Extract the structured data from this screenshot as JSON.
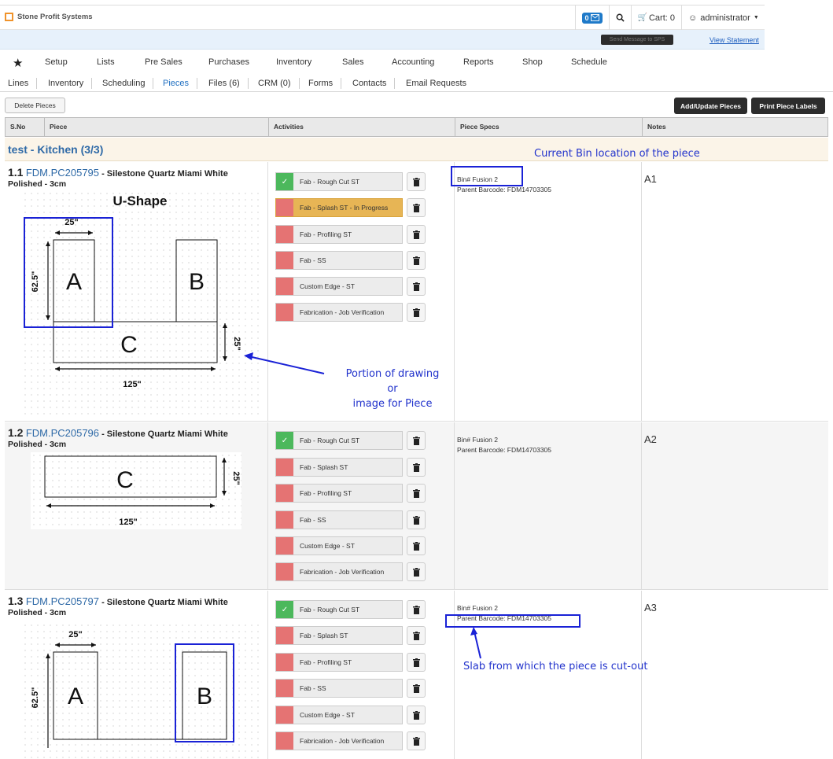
{
  "header": {
    "brand": "Stone Profit Systems",
    "message_count": "0",
    "cart_label": "Cart: 0",
    "user": "administrator"
  },
  "notice": {
    "send_message": "Send Message to SPS",
    "view_statement": "View Statement"
  },
  "nav": {
    "items": [
      "Setup",
      "Lists",
      "Pre Sales",
      "Purchases",
      "Inventory",
      "Sales",
      "Accounting",
      "Reports",
      "Shop",
      "Schedule"
    ]
  },
  "subtabs": {
    "items": [
      "Lines",
      "Inventory",
      "Scheduling",
      "Pieces",
      "Files (6)",
      "CRM (0)",
      "Forms",
      "Contacts",
      "Email Requests"
    ],
    "active": "Pieces"
  },
  "actions": {
    "delete": "Delete Pieces",
    "add_update": "Add/Update Pieces",
    "print_labels": "Print Piece Labels"
  },
  "table": {
    "headers": [
      "S.No",
      "Piece",
      "Activities",
      "Piece Specs",
      "Notes"
    ],
    "group": "test - Kitchen (3/3)",
    "pieces": [
      {
        "num": "1.1",
        "code": "FDM.PC205795",
        "material": " - Silestone Quartz Miami White",
        "finish": "Polished - 3cm",
        "bin": "Bin# Fusion 2",
        "parent": "Parent Barcode: FDM14703305",
        "note": "A1",
        "drawing_title": "U-Shape",
        "activities": [
          {
            "label": "Fab - Rough Cut ST",
            "status": "done"
          },
          {
            "label": "Fab - Splash ST - In Progress",
            "status": "progress"
          },
          {
            "label": "Fab - Profiling ST",
            "status": "todo"
          },
          {
            "label": "Fab - SS",
            "status": "todo"
          },
          {
            "label": "Custom Edge - ST",
            "status": "todo"
          },
          {
            "label": "Fabrication - Job Verification",
            "status": "todo"
          }
        ]
      },
      {
        "num": "1.2",
        "code": "FDM.PC205796",
        "material": " - Silestone Quartz Miami White",
        "finish": "Polished - 3cm",
        "bin": "Bin# Fusion 2",
        "parent": "Parent Barcode: FDM14703305",
        "note": "A2",
        "activities": [
          {
            "label": "Fab - Rough Cut ST",
            "status": "done"
          },
          {
            "label": "Fab - Splash ST",
            "status": "todo"
          },
          {
            "label": "Fab - Profiling ST",
            "status": "todo"
          },
          {
            "label": "Fab - SS",
            "status": "todo"
          },
          {
            "label": "Custom Edge - ST",
            "status": "todo"
          },
          {
            "label": "Fabrication - Job Verification",
            "status": "todo"
          }
        ]
      },
      {
        "num": "1.3",
        "code": "FDM.PC205797",
        "material": " - Silestone Quartz Miami White",
        "finish": "Polished - 3cm",
        "bin": "Bin# Fusion 2",
        "parent": "Parent Barcode: FDM14703305",
        "note": "A3",
        "activities": [
          {
            "label": "Fab - Rough Cut ST",
            "status": "done"
          },
          {
            "label": "Fab - Splash ST",
            "status": "todo"
          },
          {
            "label": "Fab - Profiling ST",
            "status": "todo"
          },
          {
            "label": "Fab - SS",
            "status": "todo"
          },
          {
            "label": "Custom Edge - ST",
            "status": "todo"
          },
          {
            "label": "Fabrication - Job Verification",
            "status": "todo"
          }
        ]
      }
    ]
  },
  "drawing_labels": {
    "a": "A",
    "b": "B",
    "c": "C",
    "dim_25": "25\"",
    "dim_625": "62.5\"",
    "dim_125": "125\""
  },
  "annotations": {
    "bin_location": "Current Bin location of the piece",
    "drawing_line1": "Portion of drawing",
    "drawing_line2": "or",
    "drawing_line3": "image for Piece",
    "slab": "Slab from which the piece is cut-out"
  },
  "colors": {
    "done": "#4cb85c",
    "todo": "#e57373",
    "progress": "#e7b555",
    "link": "#2f6aa7",
    "annotation": "#1a22d6"
  }
}
